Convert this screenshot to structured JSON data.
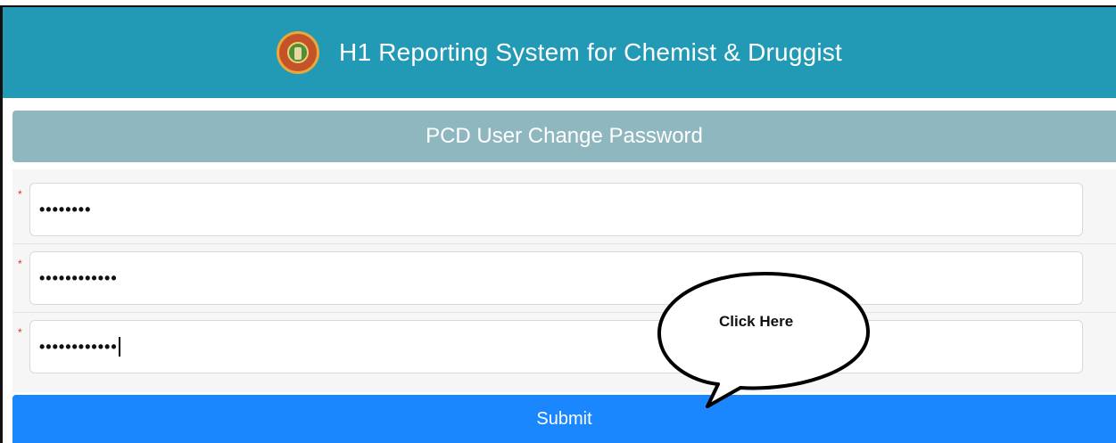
{
  "header": {
    "title": "H1 Reporting System for Chemist & Druggist",
    "emblem_icon": "state-emblem-icon",
    "background": "#2299b5"
  },
  "subheader": {
    "title": "PCD User Change Password",
    "background": "#8fb7bf"
  },
  "form": {
    "required_marker": "*",
    "fields": [
      {
        "value": "••••••••"
      },
      {
        "value": "••••••••••••"
      },
      {
        "value": "••••••••••••"
      }
    ]
  },
  "callout": {
    "text": "Click Here"
  },
  "submit": {
    "label": "Submit",
    "background": "#1a87ff"
  }
}
